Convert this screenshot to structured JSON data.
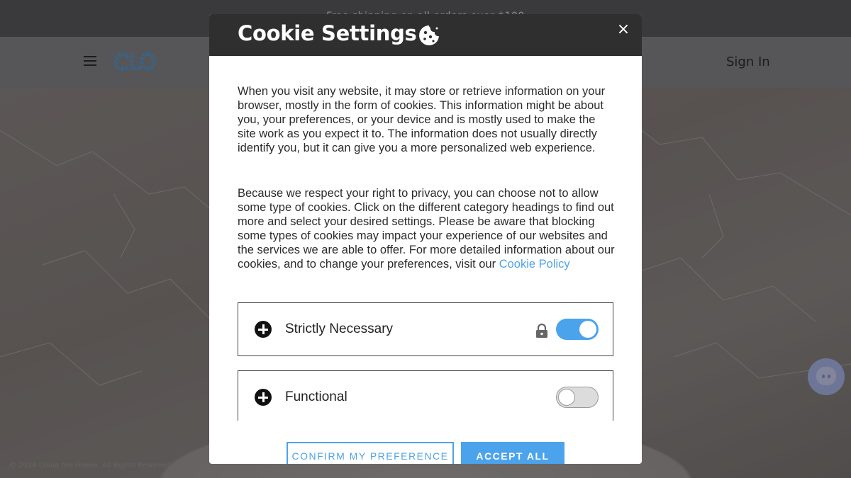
{
  "site": {
    "announcement": "Free shipping on all orders over $100",
    "sign_in_label": "Sign In",
    "logo_text": "CLO",
    "copyright": "© 2024 Olivia ten Hoeve. All Rights Reserved."
  },
  "modal": {
    "title": "Cookie Settings",
    "close_label": "×",
    "intro_paragraph": "When you visit any website, it may store or retrieve information on your browser, mostly in the form of cookies. This information might be about you, your preferences, or your device and is mostly used to make the site work as you expect it to. The information does not usually directly identify you, but it can give you a more personalized web experience.",
    "privacy_paragraph": "Because we respect your right to privacy, you can choose not to allow some type of cookies.  Click on the different category headings to find out more and select your desired settings.  Please be aware that blocking some types of cookies may impact your experience of our websites and the services we are able to offer.  For more detailed information about our cookies, and to change your preferences, visit our",
    "policy_link": "Cookie Policy",
    "categories": [
      {
        "label": "Strictly Necessary",
        "enabled": true,
        "locked": true
      },
      {
        "label": "Functional",
        "enabled": false,
        "locked": false
      }
    ],
    "confirm_label": "CONFIRM MY PREFERENCE",
    "accept_label": "ACCEPT ALL"
  },
  "colors": {
    "accent": "#4ba3ec",
    "header_dark": "#2f2f30",
    "toggle_off": "#dcdcdc"
  },
  "icons": [
    "menu-icon",
    "cookie-icon",
    "close-icon",
    "plus-circle-icon",
    "lock-icon",
    "chat-icon"
  ]
}
